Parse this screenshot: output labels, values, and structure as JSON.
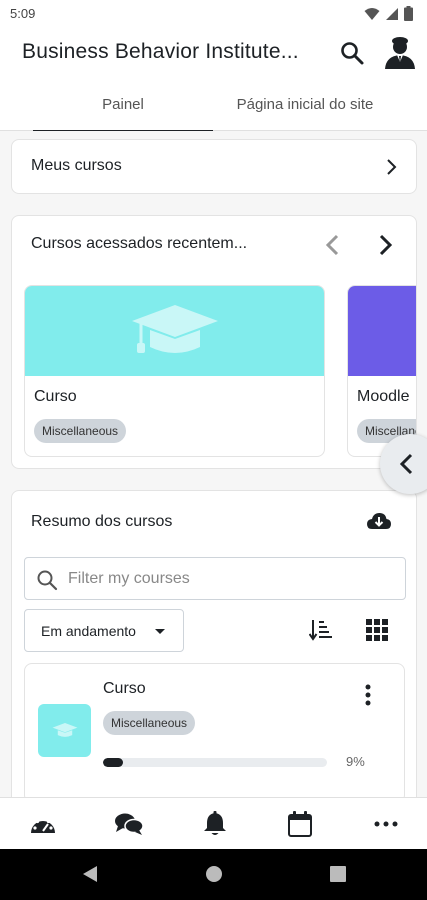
{
  "status_bar": {
    "time": "5:09"
  },
  "app_bar": {
    "title": "Business Behavior Institute..."
  },
  "tabs": [
    {
      "label": "Painel",
      "active": true
    },
    {
      "label": "Página inicial do site",
      "active": false
    }
  ],
  "my_courses": {
    "label": "Meus cursos"
  },
  "recent_courses": {
    "label": "Cursos acessados recentem...",
    "courses": [
      {
        "name": "Curso",
        "category": "Miscellaneous",
        "image_color": "#81ecec"
      },
      {
        "name": "Moodle",
        "category": "Miscellaneous",
        "image_color": "#6c5ce7"
      }
    ]
  },
  "course_overview": {
    "label": "Resumo dos cursos",
    "filter_placeholder": "Filter my courses",
    "grouping_value": "Em andamento",
    "course": {
      "name": "Curso",
      "category": "Miscellaneous",
      "progress": 9,
      "progress_label": "9%"
    }
  },
  "bottom_nav": [
    "dashboard-icon",
    "messages-icon",
    "notifications-icon",
    "calendar-icon",
    "more-icon"
  ],
  "colors": {
    "accent": "#1d2125",
    "course_cyan": "#81ecec",
    "course_purple": "#6c5ce7"
  }
}
